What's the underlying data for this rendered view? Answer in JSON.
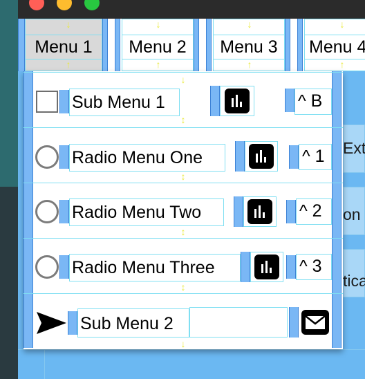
{
  "window": {
    "colors": {
      "background": "#6bb8f2",
      "titlebar": "#2b2b2b",
      "close": "#ff5f57",
      "minimize": "#febc2e",
      "zoom": "#28c840"
    }
  },
  "menubar": {
    "items": [
      {
        "label": "Menu 1",
        "active": true
      },
      {
        "label": "Menu 2"
      },
      {
        "label": "Menu 3"
      },
      {
        "label": "Menu 4"
      }
    ]
  },
  "background_labels": [
    "Extr",
    "on",
    "tica"
  ],
  "popup": {
    "items": [
      {
        "type": "checkbox",
        "label": "Sub Menu 1",
        "icon": "bar-chart-icon",
        "accelerator": "^ B"
      },
      {
        "type": "radio",
        "label": "Radio Menu One",
        "icon": "bar-chart-icon",
        "accelerator": "^ 1"
      },
      {
        "type": "radio",
        "label": "Radio Menu Two",
        "icon": "bar-chart-icon",
        "accelerator": "^ 2"
      },
      {
        "type": "radio",
        "label": "Radio Menu Three",
        "icon": "bar-chart-icon",
        "accelerator": "^ 3"
      },
      {
        "type": "submenu",
        "label": "Sub Menu 2",
        "leading_icon": "send-icon",
        "icon": "envelope-icon"
      }
    ]
  }
}
